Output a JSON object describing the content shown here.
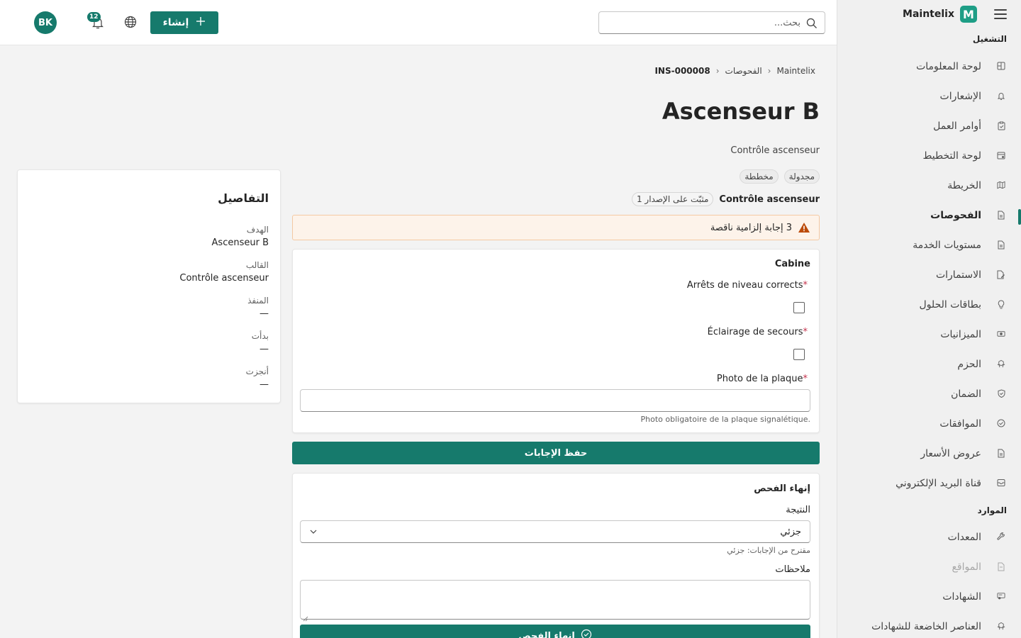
{
  "brand": {
    "name": "Maintelix",
    "logo_letter": "M",
    "accent": "#167a6c"
  },
  "topbar": {
    "search_placeholder": "بحث...",
    "create_label": "إنشاء",
    "notifications_count": "12",
    "avatar_initials": "BK"
  },
  "sidebar": {
    "section_operations": "التشغيل",
    "section_resources": "الموارد",
    "items": [
      {
        "label": "لوحة المعلومات",
        "icon": "dashboard-icon"
      },
      {
        "label": "الإشعارات",
        "icon": "bell-icon"
      },
      {
        "label": "أوامر العمل",
        "icon": "clipboard-icon"
      },
      {
        "label": "لوحة التخطيط",
        "icon": "calendar-icon"
      },
      {
        "label": "الخريطة",
        "icon": "map-icon"
      },
      {
        "label": "الفحوصات",
        "icon": "document-icon",
        "active": true
      },
      {
        "label": "مستويات الخدمة",
        "icon": "document-icon"
      },
      {
        "label": "الاستمارات",
        "icon": "form-icon"
      },
      {
        "label": "بطاقات الحلول",
        "icon": "lightbulb-icon"
      },
      {
        "label": "الميزانيات",
        "icon": "money-icon"
      },
      {
        "label": "الحزم",
        "icon": "package-icon"
      },
      {
        "label": "الضمان",
        "icon": "shield-icon"
      },
      {
        "label": "الموافقات",
        "icon": "check-circle-icon"
      },
      {
        "label": "عروض الأسعار",
        "icon": "document-icon"
      },
      {
        "label": "قناة البريد الإلكتروني",
        "icon": "mail-icon"
      }
    ],
    "resources_items": [
      {
        "label": "المعدات",
        "icon": "wrench-icon"
      },
      {
        "label": "المواقع",
        "icon": "building-icon",
        "disabled": true
      },
      {
        "label": "الشهادات",
        "icon": "certificate-icon"
      },
      {
        "label": "العناصر الخاضعة للشهادات",
        "icon": "box-icon"
      }
    ]
  },
  "breadcrumb": {
    "root": "Maintelix",
    "section": "الفحوصات",
    "current": "INS-000008"
  },
  "page": {
    "title": "Ascenseur B",
    "subtitle": "Contrôle ascenseur",
    "tags": [
      "مجدولة",
      "مخططة"
    ],
    "template_name": "Contrôle ascenseur",
    "template_version": "مثبّت على الإصدار 1"
  },
  "warning": {
    "text": "3 إجابة إلزامية ناقصة"
  },
  "form": {
    "section_title": "Cabine",
    "questions": [
      {
        "label": "Arrêts de niveau corrects",
        "required": true,
        "type": "checkbox"
      },
      {
        "label": "Éclairage de secours",
        "required": true,
        "type": "checkbox"
      },
      {
        "label": "Photo de la plaque",
        "required": true,
        "type": "text",
        "value": "",
        "hint": "Photo obligatoire de la plaque signalétique."
      }
    ],
    "save_label": "حفظ الإجابات"
  },
  "finish": {
    "title": "إنهاء الفحص",
    "result_label": "النتيجة",
    "result_value": "جزئي",
    "result_hint": "مقترح من الإجابات: جزئي",
    "notes_label": "ملاحظات",
    "notes_value": "",
    "finish_label": "إنهاء الفحص"
  },
  "details": {
    "title": "التفاصيل",
    "fields": [
      {
        "label": "الهدف",
        "value": "Ascenseur B"
      },
      {
        "label": "القالب",
        "value": "Contrôle ascenseur"
      },
      {
        "label": "المنفذ",
        "value": "—"
      },
      {
        "label": "بدأت",
        "value": "—"
      },
      {
        "label": "أنجزت",
        "value": "—"
      }
    ]
  }
}
